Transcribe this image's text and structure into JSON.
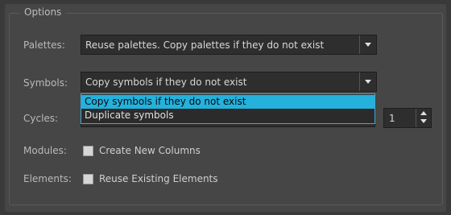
{
  "group": {
    "title": "Options"
  },
  "palettes": {
    "label": "Palettes:",
    "value": "Reuse palettes. Copy palettes if they do not exist"
  },
  "symbols": {
    "label": "Symbols:",
    "value": "Copy symbols if they do not exist",
    "options": [
      "Copy symbols if they do not exist",
      "Duplicate symbols"
    ],
    "selected_index": 0
  },
  "cycles": {
    "label": "Cycles:",
    "value": "1"
  },
  "modules": {
    "label": "Modules:",
    "checkbox_label": "Create New Columns",
    "checked": false
  },
  "elements": {
    "label": "Elements:",
    "checkbox_label": "Reuse Existing Elements",
    "checked": false
  },
  "colors": {
    "highlight": "#24b1dc",
    "focus_border": "#3fa9d8"
  },
  "icons": {
    "dropdown": "chevron-down-icon",
    "spin_up": "arrow-up-icon",
    "spin_down": "arrow-down-icon"
  }
}
